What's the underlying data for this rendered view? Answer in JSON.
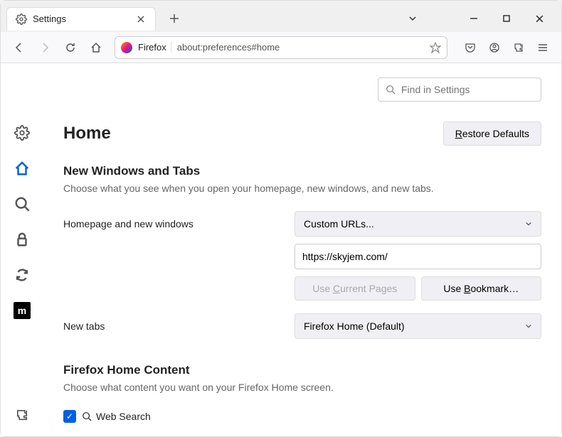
{
  "tab": {
    "title": "Settings"
  },
  "url_bar": {
    "prefix": "Firefox",
    "url": "about:preferences#home"
  },
  "search": {
    "placeholder": "Find in Settings"
  },
  "page": {
    "heading": "Home",
    "restore_button": "Restore Defaults"
  },
  "new_windows_section": {
    "title": "New Windows and Tabs",
    "description": "Choose what you see when you open your homepage, new windows, and new tabs.",
    "homepage_label": "Homepage and new windows",
    "homepage_select": "Custom URLs...",
    "homepage_value": "https://skyjem.com/",
    "use_current": "Use Current Pages",
    "use_bookmark": "Use Bookmark…",
    "newtabs_label": "New tabs",
    "newtabs_select": "Firefox Home (Default)"
  },
  "home_content_section": {
    "title": "Firefox Home Content",
    "description": "Choose what content you want on your Firefox Home screen.",
    "web_search": "Web Search"
  }
}
